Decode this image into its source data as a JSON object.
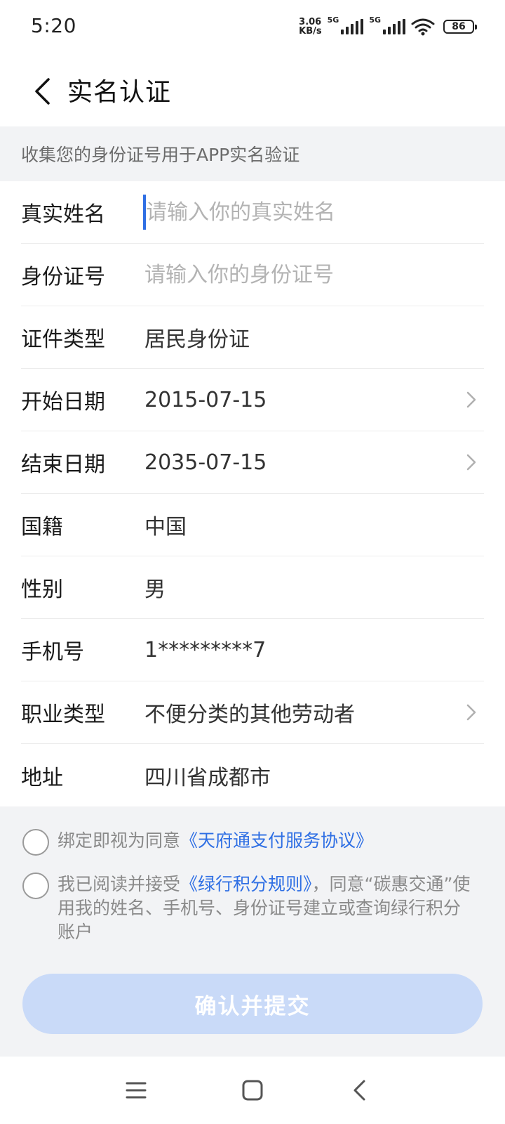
{
  "status_bar": {
    "time": "5:20",
    "net_speed_value": "3.06",
    "net_speed_unit": "KB/s",
    "sim1_label": "5G",
    "sim2_label": "5G",
    "battery": "86",
    "icons": [
      "signal-icon",
      "signal-icon",
      "wifi-icon",
      "battery-icon"
    ]
  },
  "header": {
    "title": "实名认证",
    "back_icon": "chevron-left-icon"
  },
  "notice": "收集您的身份证号用于APP实名验证",
  "form": {
    "rows": [
      {
        "label": "真实姓名",
        "placeholder": "请输入你的真实姓名",
        "value": ""
      },
      {
        "label": "身份证号",
        "placeholder": "请输入你的身份证号",
        "value": ""
      },
      {
        "label": "证件类型",
        "value": "居民身份证"
      },
      {
        "label": "开始日期",
        "value": "2015-07-15",
        "icon": "chevron-right-icon"
      },
      {
        "label": "结束日期",
        "value": "2035-07-15",
        "icon": "chevron-right-icon"
      },
      {
        "label": "国籍",
        "value": "中国"
      },
      {
        "label": "性别",
        "value": "男"
      },
      {
        "label": "手机号",
        "value": "1*********7"
      },
      {
        "label": "职业类型",
        "value": "不便分类的其他劳动者",
        "icon": "chevron-right-icon"
      },
      {
        "label": "地址",
        "value": "四川省成都市"
      }
    ]
  },
  "agreements": {
    "item1": {
      "prefix": "绑定即视为同意",
      "link": "《天府通支付服务协议》"
    },
    "item2": {
      "prefix": "我已阅读并接受",
      "link": "《绿行积分规则》",
      "suffix_line1": "，同意“碳惠交通”使",
      "line2": "用我的姓名、手机号、身份证号建立或查询绿行积分",
      "line3": "账户"
    }
  },
  "submit_label": "确认并提交",
  "nav_bar": {
    "icons": [
      "menu-icon",
      "home-square-icon",
      "back-triangle-icon"
    ]
  },
  "colors": {
    "accent": "#2f6fe4",
    "disabled_button": "#c9daf8",
    "section_bg": "#f2f3f5"
  }
}
